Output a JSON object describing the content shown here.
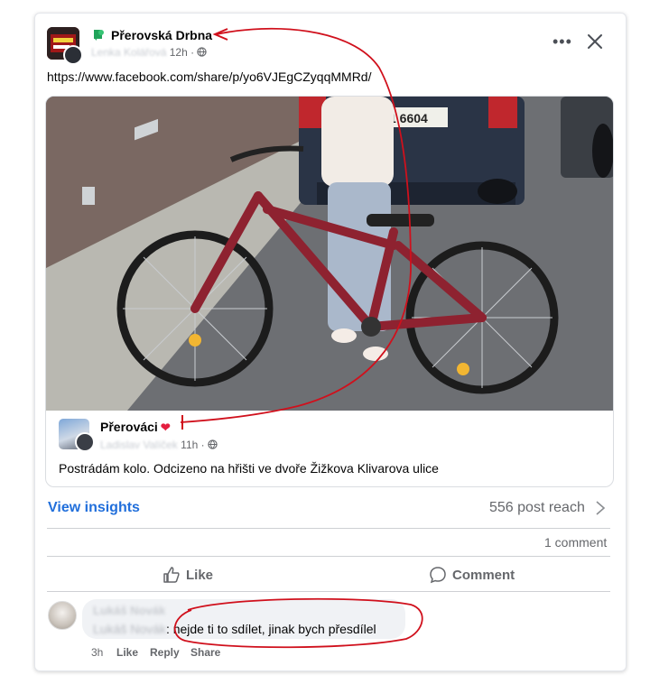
{
  "header": {
    "group_name": "Přerovská Drbna",
    "author_blurred": "Lenka Kolářová",
    "time": "12h ·",
    "more_label": "•••",
    "close_label": "✕"
  },
  "post": {
    "text": "https://www.facebook.com/share/p/yo6VJEgCZyqqMMRd/"
  },
  "photo": {
    "plate_text": "1 6604"
  },
  "shared_post": {
    "group_name": "Přerováci",
    "heart": "❤",
    "author_blurred": "Ladislav Valíček",
    "time": "11h ·",
    "text": "Postrádám kolo. Odcizeno na hřišti ve dvoře Žižkova Klivarova ulice"
  },
  "stats": {
    "insights_label": "View insights",
    "reach_label": "556 post reach",
    "comments_label": "1 comment"
  },
  "actions": {
    "like_label": "Like",
    "comment_label": "Comment"
  },
  "comment": {
    "author_blurred": "Lukáš Novák",
    "text_blurred_prefix": "Lukáš Novák",
    "text": ": nejde ti to sdílet, jinak bych přesdílel",
    "time": "3h",
    "like_label": "Like",
    "reply_label": "Reply",
    "share_label": "Share"
  },
  "colors": {
    "link_blue": "#216fdb",
    "group_icon_green": "#20a35a",
    "annotation_red": "#d0101c",
    "heart_red": "#e41e3f"
  }
}
